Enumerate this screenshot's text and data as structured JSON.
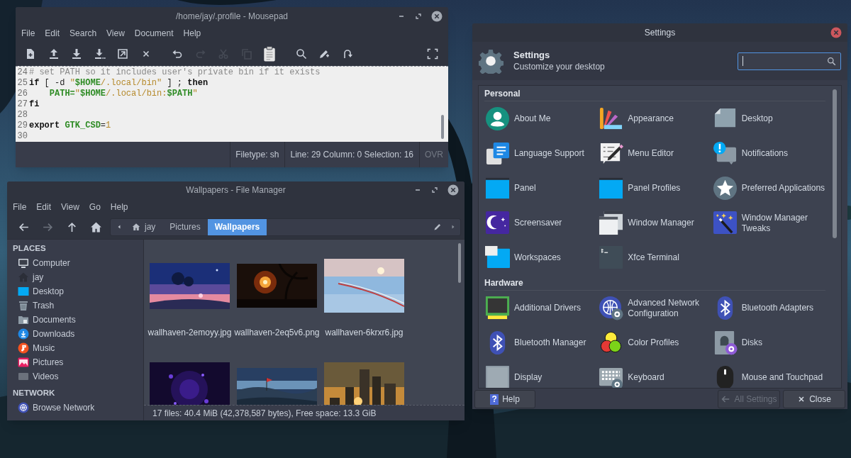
{
  "desktop": {
    "kind": "picture"
  },
  "mousepad": {
    "window": {
      "title": "/home/jay/.profile - Mousepad",
      "active": false,
      "controls": [
        {
          "kind": "minimize"
        },
        {
          "kind": "maximize"
        },
        {
          "kind": "close"
        }
      ]
    },
    "menu": [
      "File",
      "Edit",
      "Search",
      "View",
      "Document",
      "Help"
    ],
    "toolbar": [
      {
        "kind": "new",
        "disabled": false
      },
      {
        "kind": "open",
        "disabled": false
      },
      {
        "kind": "save",
        "disabled": false
      },
      {
        "kind": "save-as",
        "disabled": false
      },
      {
        "kind": "reload",
        "disabled": false
      },
      {
        "kind": "close-doc",
        "disabled": false
      },
      {
        "kind": "separator"
      },
      {
        "kind": "undo",
        "disabled": false
      },
      {
        "kind": "redo",
        "disabled": true
      },
      {
        "kind": "cut",
        "disabled": true
      },
      {
        "kind": "copy",
        "disabled": true
      },
      {
        "kind": "paste",
        "disabled": false
      },
      {
        "kind": "separator"
      },
      {
        "kind": "search",
        "disabled": false
      },
      {
        "kind": "replace",
        "disabled": false
      },
      {
        "kind": "goto",
        "disabled": false
      },
      {
        "kind": "spacer"
      },
      {
        "kind": "fullscreen",
        "disabled": false
      }
    ],
    "lines": [
      {
        "number": "24",
        "segments": [
          {
            "text": "# set PATH so it includes user's private bin if it exists",
            "kind": "comment"
          }
        ]
      },
      {
        "number": "25",
        "segments": [
          {
            "text": "if",
            "kind": "keyword"
          },
          {
            "text": " [ -d ",
            "kind": "plain"
          },
          {
            "text": "\"",
            "kind": "string"
          },
          {
            "text": "$HOME",
            "kind": "variable"
          },
          {
            "text": "/.local/bin\"",
            "kind": "string"
          },
          {
            "text": " ] ; ",
            "kind": "plain"
          },
          {
            "text": "then",
            "kind": "keyword"
          }
        ]
      },
      {
        "number": "26",
        "segments": [
          {
            "text": "    PATH=",
            "kind": "variable"
          },
          {
            "text": "\"",
            "kind": "string"
          },
          {
            "text": "$HOME",
            "kind": "variable"
          },
          {
            "text": "/.local/bin:",
            "kind": "string"
          },
          {
            "text": "$PATH",
            "kind": "variable"
          },
          {
            "text": "\"",
            "kind": "string"
          }
        ]
      },
      {
        "number": "27",
        "segments": [
          {
            "text": "fi",
            "kind": "keyword"
          }
        ]
      },
      {
        "number": "28"
      },
      {
        "number": "29",
        "segments": [
          {
            "text": "export ",
            "kind": "keyword"
          },
          {
            "text": "GTK_CSD",
            "kind": "variable"
          },
          {
            "text": "=",
            "kind": "plain"
          },
          {
            "text": "1",
            "kind": "number"
          }
        ]
      },
      {
        "number": "30"
      }
    ],
    "status_bar": {
      "filetype": "Filetype: sh",
      "position": "Line: 29 Column: 0 Selection: 16",
      "overwrite_label": "OVR",
      "overwrite": false
    }
  },
  "file_manager": {
    "window": {
      "title": "Wallpapers - File Manager",
      "active": false,
      "controls": [
        {
          "kind": "minimize"
        },
        {
          "kind": "maximize"
        },
        {
          "kind": "close"
        }
      ]
    },
    "menu": [
      "File",
      "Edit",
      "View",
      "Go",
      "Help"
    ],
    "nav": [
      {
        "kind": "back",
        "disabled": false
      },
      {
        "kind": "forward",
        "disabled": true
      },
      {
        "kind": "up",
        "disabled": false
      },
      {
        "kind": "home",
        "disabled": false
      }
    ],
    "path": [
      {
        "label": "jay",
        "kind": "home",
        "selected": false
      },
      {
        "label": "Pictures",
        "kind": "folder",
        "selected": false
      },
      {
        "label": "Wallpapers",
        "kind": "folder",
        "selected": true
      }
    ],
    "sidebar": [
      {
        "heading": "PLACES",
        "items": [
          {
            "label": "Computer",
            "kind": "computer"
          },
          {
            "label": "jay",
            "kind": "home"
          },
          {
            "label": "Desktop",
            "kind": "desktop"
          },
          {
            "label": "Trash",
            "kind": "trash"
          },
          {
            "label": "Documents",
            "kind": "documents"
          },
          {
            "label": "Downloads",
            "kind": "downloads"
          },
          {
            "label": "Music",
            "kind": "music"
          },
          {
            "label": "Pictures",
            "kind": "pictures"
          },
          {
            "label": "Videos",
            "kind": "videos"
          }
        ]
      },
      {
        "heading": "NETWORK",
        "items": [
          {
            "label": "Browse Network",
            "kind": "network"
          }
        ]
      }
    ],
    "files": [
      {
        "name": "wallhaven-2emoyy.jpg",
        "kind": "picture"
      },
      {
        "name": "wallhaven-2eq5v6.png",
        "kind": "picture"
      },
      {
        "name": "wallhaven-6krxr6.jpg",
        "kind": "picture"
      },
      {
        "kind": "picture"
      },
      {
        "kind": "picture"
      },
      {
        "kind": "picture"
      }
    ],
    "status_bar": "17 files: 40.4 MiB (42,378,587 bytes), Free space: 13.3 GiB"
  },
  "settings": {
    "window": {
      "title": "Settings",
      "active": true,
      "controls": [
        {
          "kind": "close"
        }
      ]
    },
    "header": {
      "title": "Settings",
      "subtitle": "Customize your desktop"
    },
    "search": {
      "focused": true
    },
    "sections": [
      {
        "title": "Personal",
        "items": [
          {
            "label": "About Me",
            "kind": "about-me"
          },
          {
            "label": "Appearance",
            "kind": "appearance"
          },
          {
            "label": "Desktop",
            "kind": "desktop"
          },
          {
            "label": "Language Support",
            "kind": "language"
          },
          {
            "label": "Menu Editor",
            "kind": "menu-editor"
          },
          {
            "label": "Notifications",
            "kind": "notifications"
          },
          {
            "label": "Panel",
            "kind": "panel"
          },
          {
            "label": "Panel Profiles",
            "kind": "panel"
          },
          {
            "label": "Preferred Applications",
            "kind": "preferred"
          },
          {
            "label": "Screensaver",
            "kind": "screensaver"
          },
          {
            "label": "Window Manager",
            "kind": "window-manager"
          },
          {
            "label": "Window Manager Tweaks",
            "kind": "wm-tweaks"
          },
          {
            "label": "Workspaces",
            "kind": "workspaces"
          },
          {
            "label": "Xfce Terminal",
            "kind": "terminal"
          }
        ]
      },
      {
        "title": "Hardware",
        "items": [
          {
            "label": "Additional Drivers",
            "kind": "drivers"
          },
          {
            "label": "Advanced Network Configuration",
            "kind": "network"
          },
          {
            "label": "Bluetooth Adapters",
            "kind": "bluetooth"
          },
          {
            "label": "Bluetooth Manager",
            "kind": "bluetooth"
          },
          {
            "label": "Color Profiles",
            "kind": "color"
          },
          {
            "label": "Disks",
            "kind": "disks"
          },
          {
            "label": "Display",
            "kind": "display"
          },
          {
            "label": "Keyboard",
            "kind": "keyboard"
          },
          {
            "label": "Mouse and Touchpad",
            "kind": "mouse"
          }
        ]
      }
    ],
    "buttons": [
      {
        "label": "Help",
        "kind": "help",
        "icon": "?",
        "disabled": false
      },
      {
        "label": "All Settings",
        "kind": "back",
        "disabled": true
      },
      {
        "label": "Close",
        "kind": "close",
        "disabled": false
      }
    ]
  }
}
